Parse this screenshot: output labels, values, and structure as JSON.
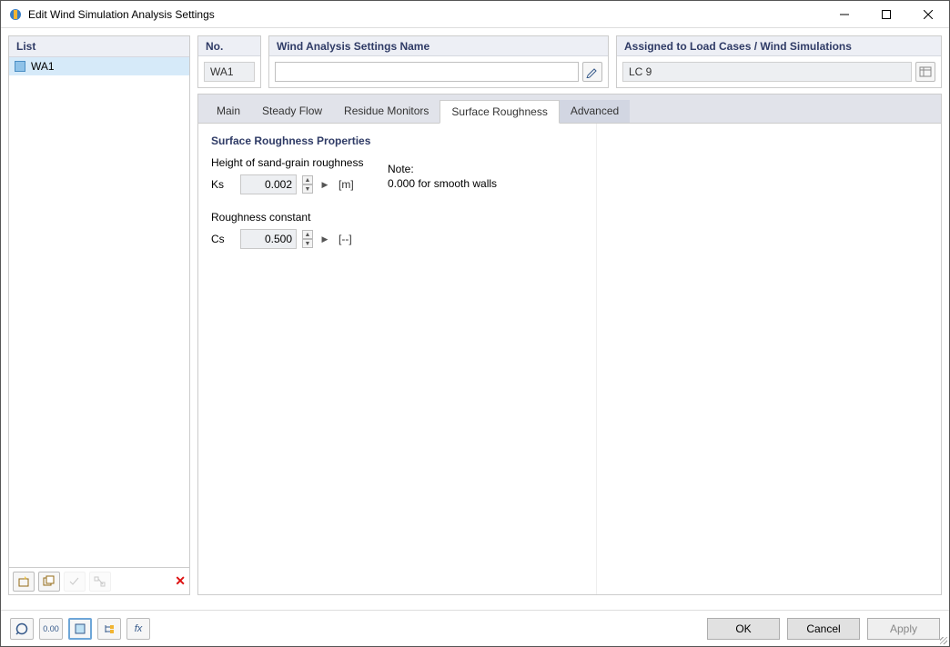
{
  "window": {
    "title": "Edit Wind Simulation Analysis Settings"
  },
  "list": {
    "header": "List",
    "items": [
      "WA1"
    ]
  },
  "no": {
    "header": "No.",
    "value": "WA1"
  },
  "name": {
    "header": "Wind Analysis Settings Name",
    "value": ""
  },
  "assigned": {
    "header": "Assigned to Load Cases / Wind Simulations",
    "value": "LC 9"
  },
  "tabs": {
    "main": "Main",
    "steady": "Steady Flow",
    "residue": "Residue Monitors",
    "roughness": "Surface Roughness",
    "advanced": "Advanced"
  },
  "props": {
    "section": "Surface Roughness Properties",
    "ks_label": "Height of sand-grain roughness",
    "ks_sym": "Ks",
    "ks_val": "0.002",
    "ks_unit": "[m]",
    "cs_label": "Roughness constant",
    "cs_sym": "Cs",
    "cs_val": "0.500",
    "cs_unit": "[--]",
    "note_head": "Note:",
    "note_body": "0.000 for smooth walls"
  },
  "footer": {
    "ok": "OK",
    "cancel": "Cancel",
    "apply": "Apply"
  }
}
